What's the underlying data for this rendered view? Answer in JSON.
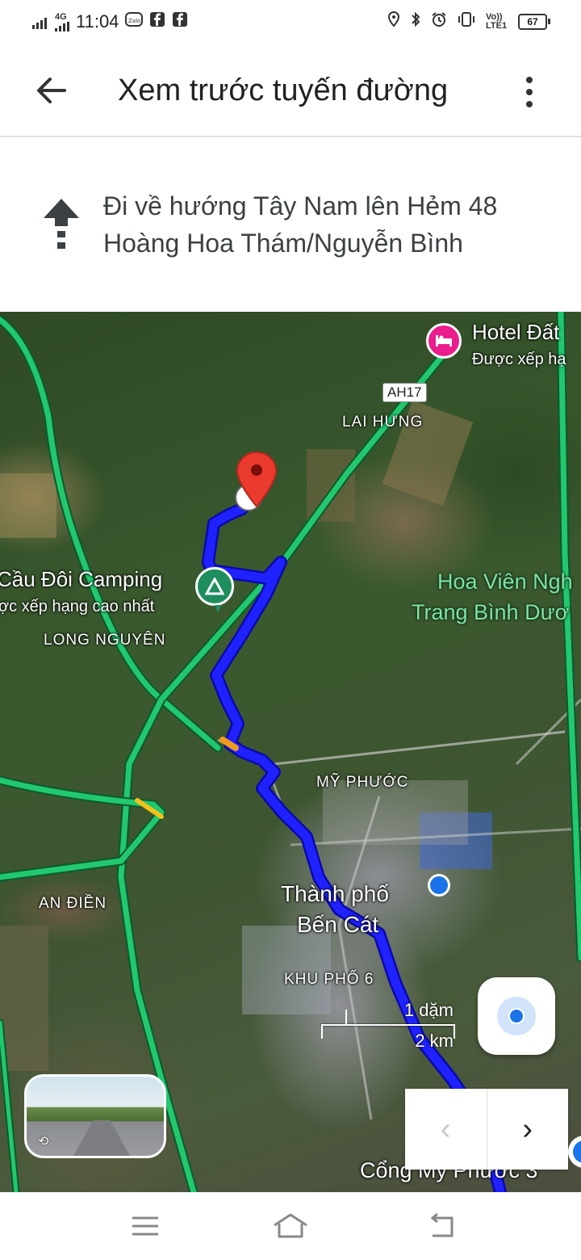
{
  "status_bar": {
    "network": "4G",
    "time": "11:04",
    "notification_icons": [
      "zalo-icon",
      "facebook-icon",
      "facebook-icon"
    ],
    "right_icons": [
      "location-icon",
      "bluetooth-icon",
      "alarm-icon",
      "vibrate-icon"
    ],
    "volte": "Vo)) LTE1",
    "battery": "67"
  },
  "app_bar": {
    "title": "Xem trước tuyến đường",
    "back_icon": "arrow-back-icon",
    "more_icon": "more-vert-icon"
  },
  "instruction": {
    "icon": "straight-arrow-icon",
    "text": "Đi về hướng Tây Nam lên Hẻm 48 Hoàng Hoa Thám/Nguyễn Bình"
  },
  "map": {
    "hotel": {
      "name": "Hotel Đất",
      "rating": "Được xếp hạ"
    },
    "road_shield": "AH17",
    "areas": {
      "lai_hung": "LAI HƯNG",
      "long_nguyen": "LONG NGUYÊN",
      "my_phuoc": "MỸ PHƯỚC",
      "an_dien": "AN ĐIỀN",
      "khu_pho_6": "KHU PHỐ 6"
    },
    "camping": {
      "name": "Cầu Đôi Camping",
      "rating": "ợc xếp hạng cao nhất"
    },
    "hoa_vien": {
      "line1": "Hoa Viên Ngh",
      "line2": "Trang Bình Dươ"
    },
    "city": {
      "line1": "Thành phố",
      "line2": "Bến Cát"
    },
    "bottom_label": "Cổng Mỹ Phước 3",
    "scale": {
      "miles": "1 dặm",
      "km": "2 km"
    },
    "route_color": "#1a1aff",
    "highway_color": "#22c86e"
  },
  "controls": {
    "prev_glyph": "‹",
    "next_glyph": "›"
  }
}
